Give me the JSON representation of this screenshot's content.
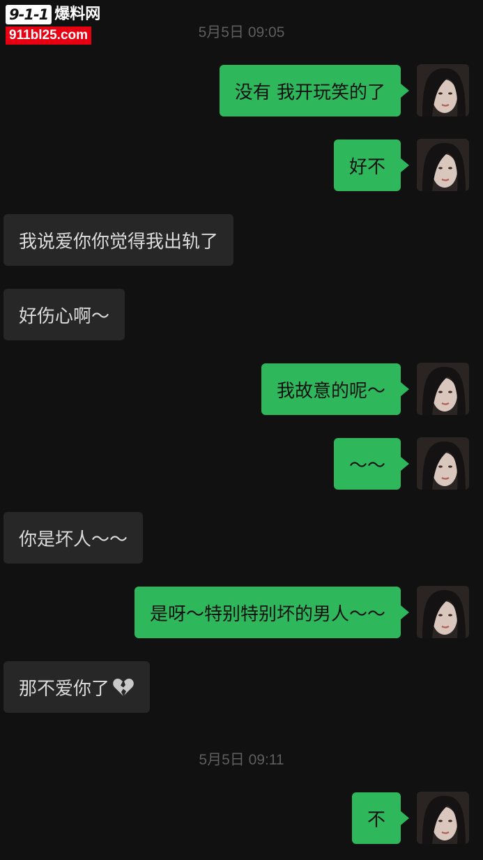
{
  "watermark": {
    "logo": "9-1-1",
    "title": "爆料网",
    "url": "911bl25.com"
  },
  "timestamps": [
    "5月5日 09:05",
    "5月5日 09:11"
  ],
  "messages": [
    {
      "side": "right",
      "text": "没有 我开玩笑的了"
    },
    {
      "side": "right",
      "text": "好不"
    },
    {
      "side": "left",
      "text": "我说爱你你觉得我出轨了"
    },
    {
      "side": "left",
      "text": "好伤心啊～"
    },
    {
      "side": "right",
      "text": "我故意的呢～"
    },
    {
      "side": "right",
      "text": "～～"
    },
    {
      "side": "left",
      "text": "你是坏人～～"
    },
    {
      "side": "right",
      "text": "是呀～特别特别坏的男人～～"
    },
    {
      "side": "left",
      "text": "那不爱你了",
      "emoji": "broken-heart-icon"
    },
    {
      "side": "right",
      "text": "不"
    }
  ],
  "colors": {
    "background": "#111112",
    "outgoing_bubble": "#2fb75c",
    "incoming_bubble": "#272728",
    "timestamp": "#5e5e5e"
  }
}
